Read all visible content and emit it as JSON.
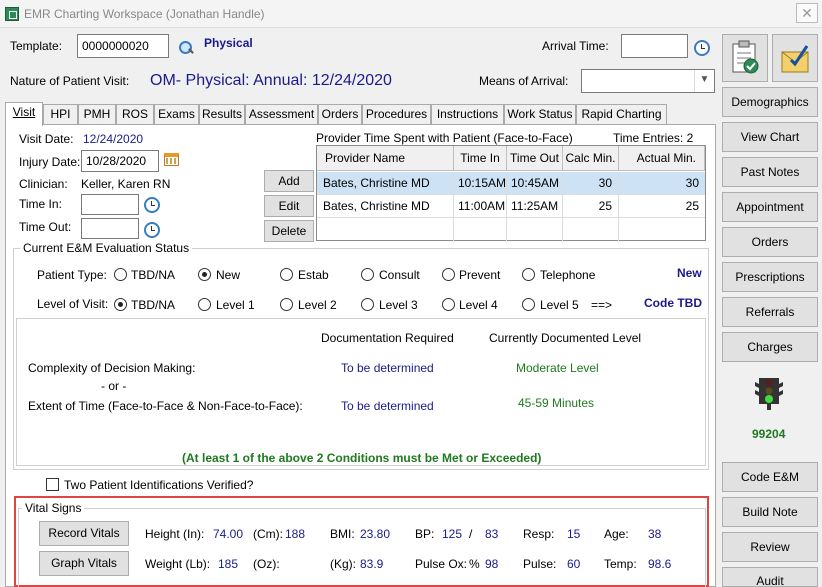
{
  "window": {
    "title": "EMR Charting Workspace (Jonathan Handle)"
  },
  "header": {
    "template_label": "Template:",
    "template_value": "0000000020",
    "template_name": "Physical",
    "arrival_time_label": "Arrival Time:",
    "arrival_time_value": "",
    "nature_label": "Nature of Patient Visit:",
    "nature_value": "OM- Physical: Annual: 12/24/2020",
    "means_label": "Means of Arrival:",
    "means_value": ""
  },
  "tabs": [
    "Visit",
    "HPI",
    "PMH",
    "ROS",
    "Exams",
    "Results",
    "Assessment",
    "Orders",
    "Procedures",
    "Instructions",
    "Work Status",
    "Rapid Charting"
  ],
  "visit": {
    "visit_date_label": "Visit Date:",
    "visit_date": "12/24/2020",
    "injury_date_label": "Injury Date:",
    "injury_date": "10/28/2020",
    "clinician_label": "Clinician:",
    "clinician": "Keller, Karen  RN",
    "time_in_label": "Time In:",
    "time_out_label": "Time Out:",
    "time_in": "",
    "time_out": ""
  },
  "provider_time": {
    "title": "Provider Time Spent with Patient (Face-to-Face)",
    "entries": "Time Entries: 2",
    "buttons": {
      "add": "Add",
      "edit": "Edit",
      "delete": "Delete"
    },
    "columns": [
      "Provider Name",
      "Time In",
      "Time Out",
      "Calc Min.",
      "Actual Min."
    ],
    "rows": [
      [
        "Bates, Christine  MD",
        "10:15AM",
        "10:45AM",
        "30",
        "30"
      ],
      [
        "Bates, Christine  MD",
        "11:00AM",
        "11:25AM",
        "25",
        "25"
      ]
    ]
  },
  "em_status": {
    "title": "Current E&M Evaluation Status",
    "patient_type_label": "Patient Type:",
    "patient_types": [
      "TBD/NA",
      "New",
      "Estab",
      "Consult",
      "Prevent",
      "Telephone"
    ],
    "patient_type_selected": "New",
    "patient_type_result": "New",
    "level_label": "Level of Visit:",
    "levels": [
      "TBD/NA",
      "Level 1",
      "Level 2",
      "Level 3",
      "Level 4",
      "Level 5"
    ],
    "level_selected": "TBD/NA",
    "arrow": "==>",
    "level_result": "Code TBD",
    "doc_required_header": "Documentation Required",
    "doc_current_header": "Currently Documented Level",
    "complexity_label": "Complexity of Decision Making:",
    "or_label": "- or -",
    "complexity_required": "To be determined",
    "complexity_current": "Moderate Level",
    "extent_label": "Extent of Time (Face-to-Face & Non-Face-to-Face):",
    "extent_required": "To be determined",
    "extent_current": "45-59 Minutes",
    "conditions_note": "(At least 1 of the above 2 Conditions must be Met or Exceeded)"
  },
  "identification": {
    "label": "Two Patient Identifications Verified?",
    "checked": false
  },
  "vitals": {
    "title": "Vital Signs",
    "record_button": "Record Vitals",
    "graph_button": "Graph Vitals",
    "height_in_label": "Height (In):",
    "height_in": "74.00",
    "height_cm_label": "(Cm):",
    "height_cm": "188",
    "bmi_label": "BMI:",
    "bmi": "23.80",
    "bp_label": "BP:",
    "bp_sys": "125",
    "bp_sep": "/",
    "bp_dia": "83",
    "resp_label": "Resp:",
    "resp": "15",
    "age_label": "Age:",
    "age": "38",
    "weight_lb_label": "Weight (Lb):",
    "weight_lb": "185",
    "oz_label": "(Oz):",
    "oz": "",
    "kg_label": "(Kg):",
    "kg": "83.9",
    "pulse_ox_label": "Pulse Ox:",
    "pulse_ox_unit": "%",
    "pulse_ox": "98",
    "pulse_label": "Pulse:",
    "pulse": "60",
    "temp_label": "Temp:",
    "temp": "98.6"
  },
  "sidebar": {
    "items": [
      "Demographics",
      "View Chart",
      "Past Notes",
      "Appointment",
      "Orders",
      "Prescriptions",
      "Referrals",
      "Charges",
      "Code E&M",
      "Build Note",
      "Review",
      "Audit"
    ],
    "em_code": "99204",
    "traffic_light_state": "green"
  },
  "colors": {
    "highlight": "#e04545",
    "link_blue": "#1a1a8c",
    "doc_green": "#1e7a1e"
  }
}
